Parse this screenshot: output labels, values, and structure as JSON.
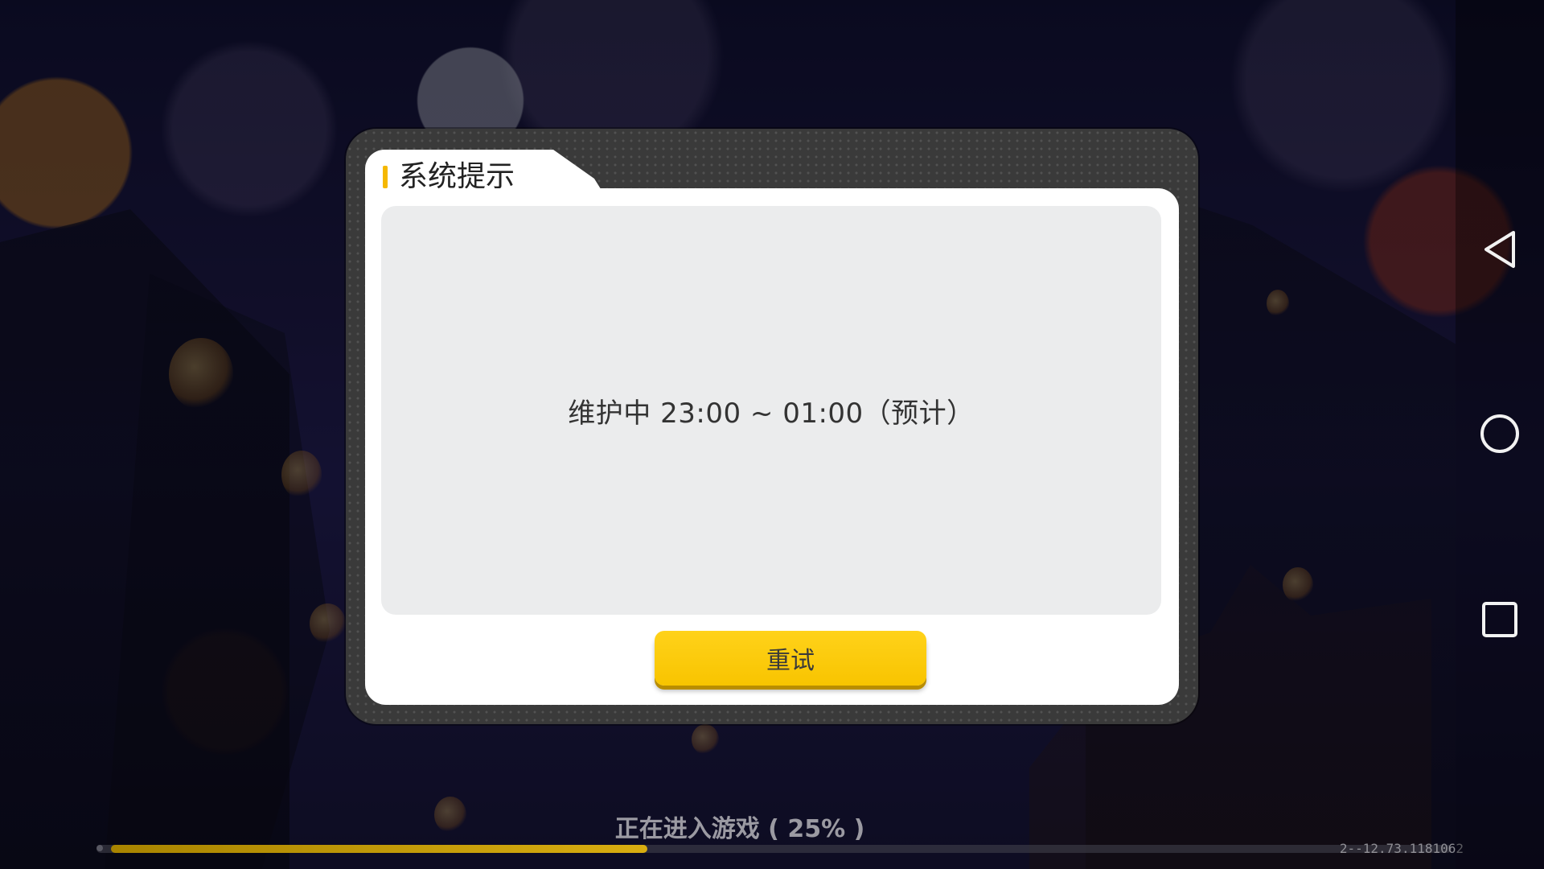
{
  "dialog": {
    "title": "系统提示",
    "message": "维护中 23:00 ~ 01:00（预计）",
    "retry_label": "重试"
  },
  "loading": {
    "status_text": "正在进入游戏 ( 25% )",
    "progress": 0.25
  },
  "version": "2--12.73.1181062",
  "nav": {
    "back_icon": "back-triangle-icon",
    "home_icon": "home-circle-icon",
    "recent_icon": "recent-square-icon"
  },
  "colors": {
    "accent": "#f8c400",
    "dialog_frame": "#3a3a3a",
    "panel": "#ebeced"
  }
}
